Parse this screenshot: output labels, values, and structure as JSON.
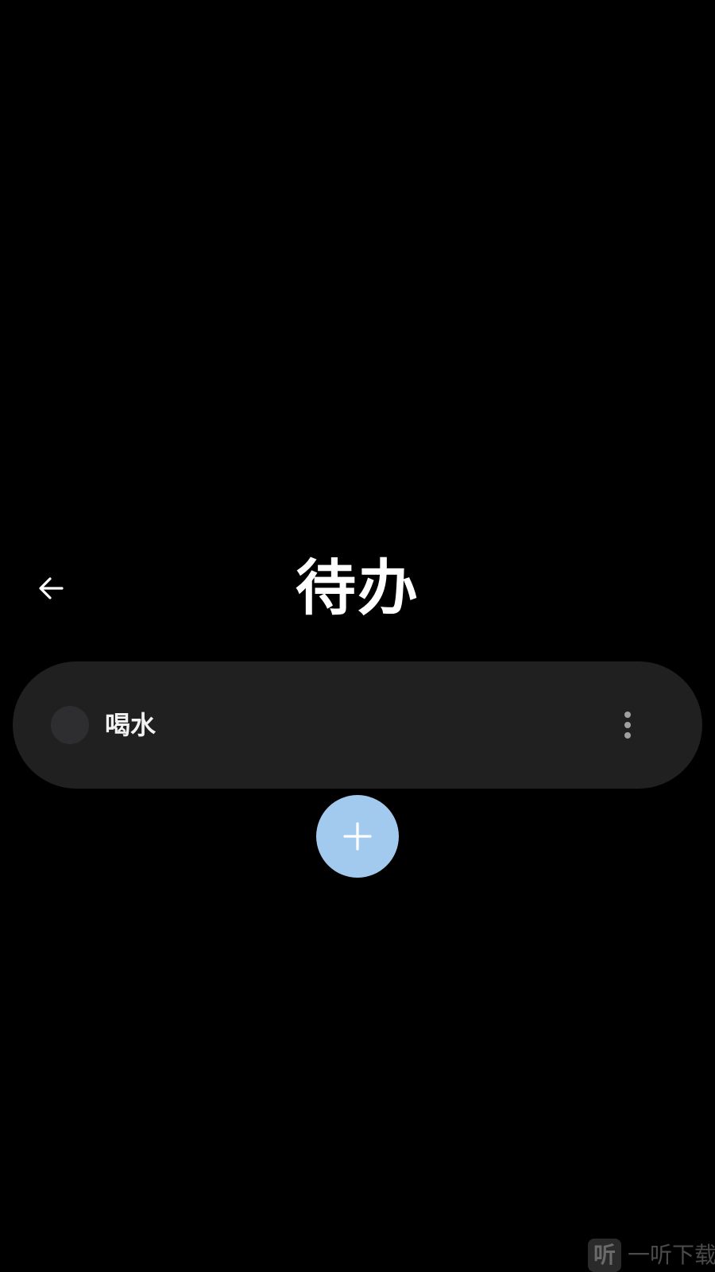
{
  "header": {
    "title": "待办",
    "back_icon": "arrow-left-icon"
  },
  "todos": [
    {
      "label": "喝水",
      "completed": false,
      "menu_icon": "more-vertical-icon"
    }
  ],
  "fab": {
    "icon": "plus-icon",
    "color": "#a2c9ee"
  },
  "watermark": {
    "logo_glyph": "听",
    "text": "一听下载"
  },
  "colors": {
    "background": "#000000",
    "card": "#202020",
    "checkbox": "#2e2e30",
    "title_text": "#ffffff",
    "item_text": "#f2f2f2"
  }
}
